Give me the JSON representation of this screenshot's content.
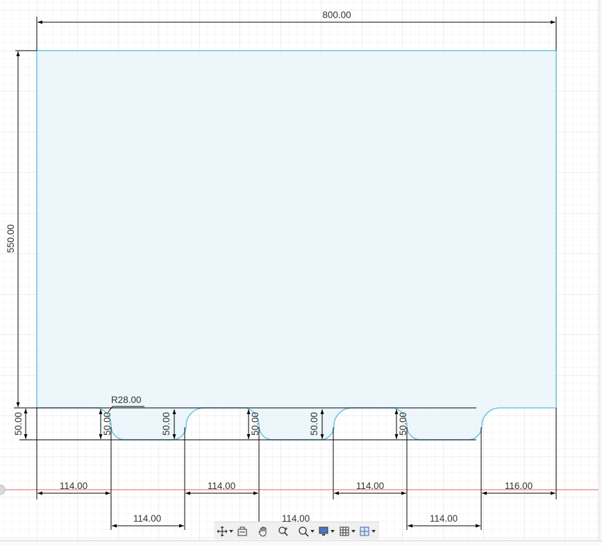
{
  "dimensions": {
    "overall_width": "800.00",
    "overall_height": "550.00",
    "tab_depth": "50.00",
    "fillet_radius": "R28.00",
    "slot_depth_labels": [
      "50.00",
      "50.00",
      "50.00",
      "50.00",
      "50.00",
      "50.00"
    ],
    "upper_spacings": [
      "114.00",
      "114.00",
      "114.00",
      "116.00"
    ],
    "lower_spacings": [
      "114.00",
      "114.00",
      "114.00"
    ]
  },
  "colors": {
    "profile_fill": "#eaf4fa",
    "profile_stroke": "#6ec6e6",
    "grid_minor": "#eeeeee",
    "grid_major": "#dcdcdc",
    "dimension_line": "#000000",
    "axis_red": "#e06a6a"
  },
  "toolbar": {
    "buttons": [
      {
        "icon": "orbit-icon",
        "has_dropdown": true
      },
      {
        "icon": "look-at-icon",
        "has_dropdown": false
      },
      {
        "icon": "pan-icon",
        "has_dropdown": false
      },
      {
        "icon": "zoom-icon",
        "has_dropdown": false
      },
      {
        "icon": "fit-icon",
        "has_dropdown": true
      },
      {
        "icon": "display-settings-icon",
        "has_dropdown": true
      },
      {
        "icon": "grid-settings-icon",
        "has_dropdown": true
      },
      {
        "icon": "viewports-icon",
        "has_dropdown": true
      }
    ]
  }
}
